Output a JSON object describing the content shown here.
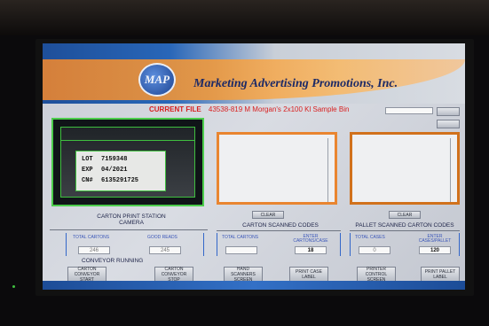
{
  "header": {
    "logo_text": "MAP",
    "company_name": "Marketing Advertising Promotions, Inc."
  },
  "current_file": {
    "label": "CURRENT FILE",
    "value": "43538-819 M Morgan's 2x100 Kl Sample Bin"
  },
  "camera": {
    "lot_label": "LOT",
    "lot_value": "7159348",
    "exp_label": "EXP",
    "exp_value": "04/2021",
    "cn_label": "CN#",
    "cn_value": "6135291725"
  },
  "top_buttons": {
    "btn1": "",
    "btn2": ""
  },
  "sections": {
    "station_title_line1": "CARTON PRINT STATION",
    "station_title_line2": "CAMERA",
    "clear_carton": "CLEAR",
    "carton_scanned_title": "CARTON SCANNED CODES",
    "clear_pallet": "CLEAR",
    "pallet_scanned_title": "PALLET SCANNED CARTON CODES"
  },
  "station_fields": {
    "total_cartons_label": "TOTAL CARTONS",
    "good_reads_label": "GOOD READS",
    "total_cartons_value": "246",
    "good_reads_value": "245"
  },
  "carton_fields": {
    "total_cartons_label": "TOTAL CARTONS",
    "enter_label": "ENTER CARTONS/CASE",
    "total_cartons_value": "",
    "enter_value": "18"
  },
  "pallet_fields": {
    "total_cases_label": "TOTAL CASES",
    "enter_label": "ENTER CASES/PALLET",
    "total_cases_value": "0",
    "enter_value": "120"
  },
  "status": {
    "conveyor": "CONVEYOR RUNNING"
  },
  "bottom_buttons": [
    "CARTON CONVEYOR START",
    "CARTON CONVEYOR STOP",
    "HAND SCANNERS SCREEN",
    "PRINT CASE LABEL",
    "PRINTER CONTROL SCREEN",
    "PRINT PALLET LABEL"
  ],
  "colors": {
    "accent_orange": "#e98530",
    "brand_blue": "#1e4f9a",
    "camera_green": "#4ccd4c",
    "file_red": "#d82020"
  }
}
